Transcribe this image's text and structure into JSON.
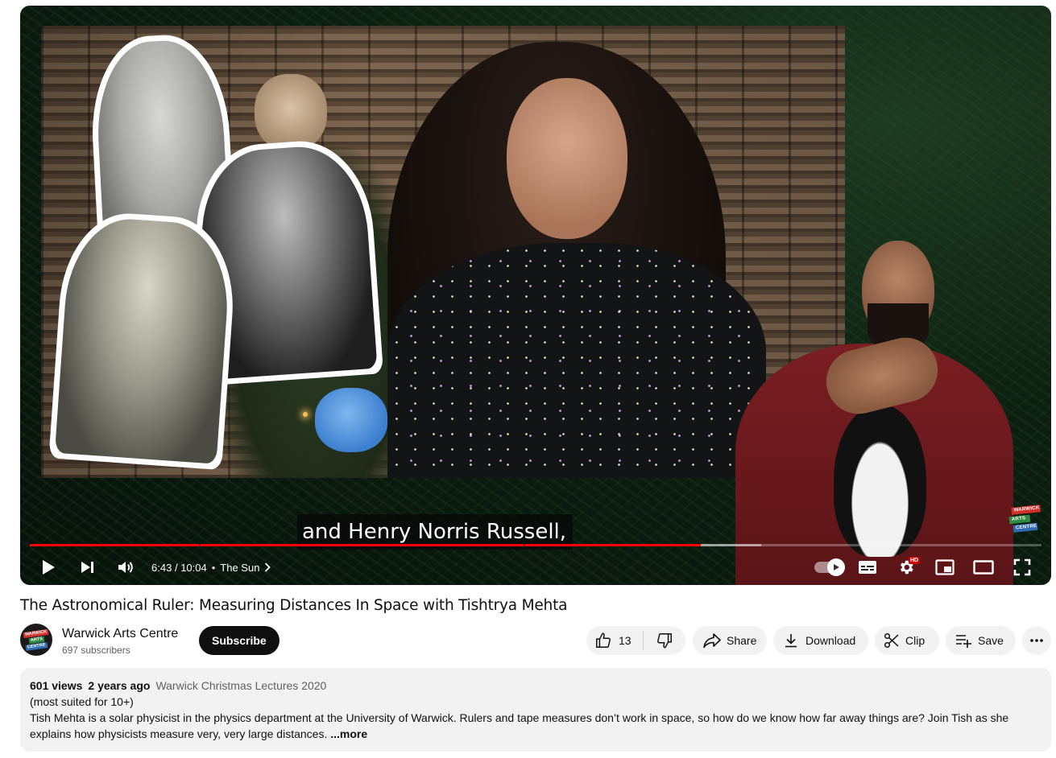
{
  "player": {
    "caption": "and Henry Norris Russell,",
    "current_time": "6:43",
    "duration": "10:04",
    "time_separator": "/",
    "chapter_bullet": "•",
    "chapter": "The Sun",
    "progress_played_fraction": 0.663,
    "progress_buffered_fraction": 0.723,
    "chapter_markers_fraction": [
      0.167,
      0.488
    ],
    "hd_badge": "HD",
    "logo_lines": [
      "WARWICK",
      "ARTS",
      "CENTRE"
    ],
    "icons": [
      "play-icon",
      "next-icon",
      "volume-icon",
      "chevron-right-icon",
      "autoplay-icon",
      "subtitles-icon",
      "settings-icon",
      "miniplayer-icon",
      "theater-icon",
      "fullscreen-icon"
    ],
    "colors": {
      "progress": "#ff0000",
      "hd": "#cc0000"
    }
  },
  "video": {
    "title": "The Astronomical Ruler: Measuring Distances In Space with Tishtrya Mehta"
  },
  "channel": {
    "name": "Warwick Arts Centre",
    "subscribers": "697 subscribers",
    "avatar_lines": [
      "WARWICK",
      "ARTS",
      "CENTRE"
    ],
    "subscribe_label": "Subscribe"
  },
  "actions": {
    "like_count": "13",
    "share_label": "Share",
    "download_label": "Download",
    "clip_label": "Clip",
    "save_label": "Save",
    "icons": [
      "thumbs-up-icon",
      "thumbs-down-icon",
      "share-icon",
      "download-icon",
      "scissors-icon",
      "playlist-add-icon",
      "more-icon"
    ]
  },
  "description": {
    "views": "601 views",
    "age": "2 years ago",
    "playlist": "Warwick Christmas Lectures 2020",
    "line1": "(most suited for 10+)",
    "text": "Tish Mehta is a solar physicist in the physics department at the University of Warwick. Rulers and tape measures don’t work in space, so how do we know how far away things are? Join Tish as she explains how physicists measure very, very large distances.",
    "more_label": "...more"
  }
}
